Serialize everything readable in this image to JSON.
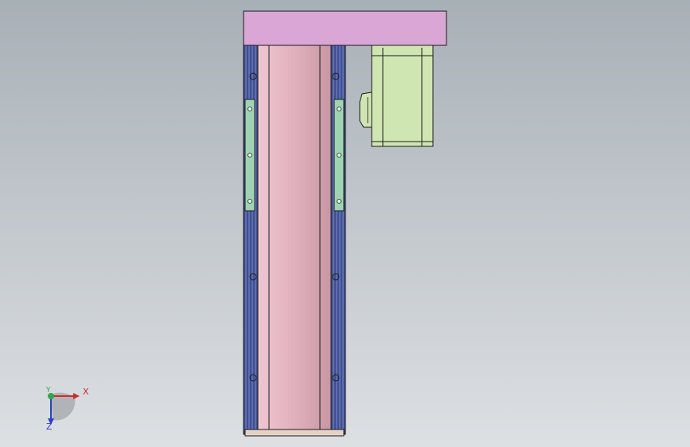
{
  "viewport": {
    "background_top": "#a8b0b7",
    "background_bottom": "#dde0e3"
  },
  "model": {
    "top_plate_color": "#d9a6d6",
    "rail_color": "#404f8e",
    "rail_stripe_color": "#7d8bd1",
    "tube_color": "#e2b3c0",
    "tube_shade_color": "#c999a6",
    "carriage_color": "#9fd4b3",
    "motor_color": "#cfe6b2",
    "edge_color": "#1c1c1c"
  },
  "triad": {
    "x_label": "X",
    "y_label": "Y",
    "z_label": "Z",
    "x_color": "#d12b2b",
    "y_color": "#2fa84a",
    "z_color": "#2b3fc4"
  }
}
